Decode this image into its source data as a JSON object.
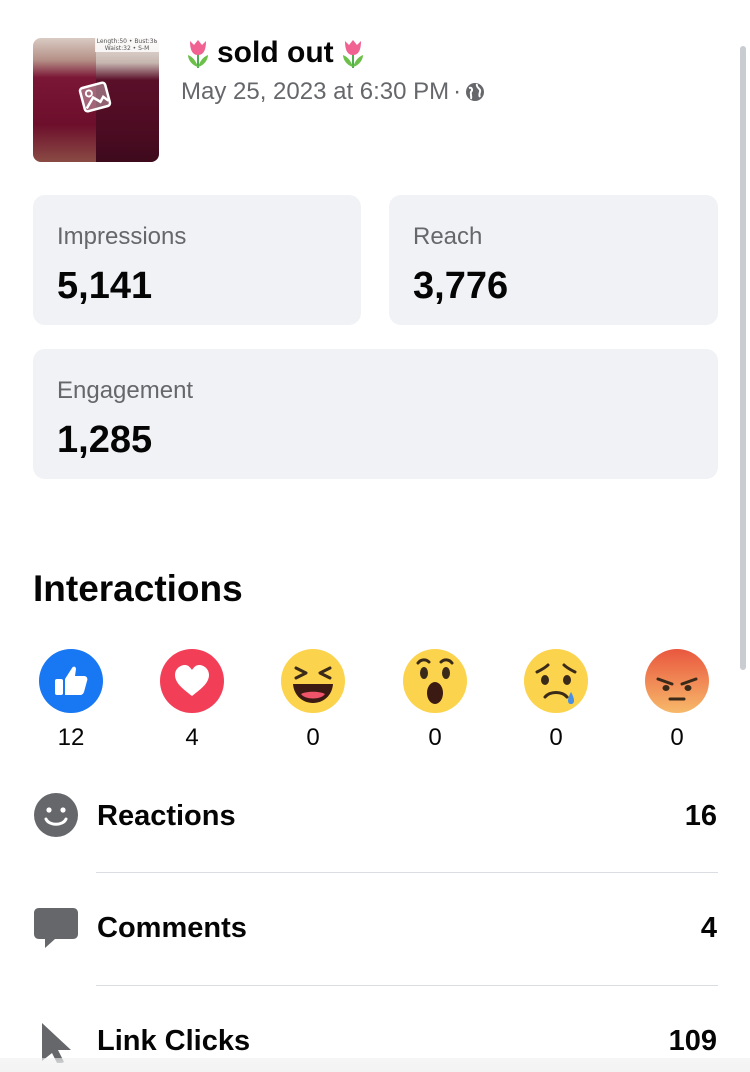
{
  "post": {
    "thumbnail_text": "Length:50 • Bust:38 Waist:32 • S-M",
    "title": "sold out",
    "date": "May 25, 2023 at 6:30 PM",
    "separator": "·"
  },
  "stats": [
    {
      "label": "Impressions",
      "value": "5,141"
    },
    {
      "label": "Reach",
      "value": "3,776"
    },
    {
      "label": "Engagement",
      "value": "1,285"
    }
  ],
  "interactions": {
    "title": "Interactions",
    "reactions": [
      {
        "icon": "like-icon",
        "count": "12"
      },
      {
        "icon": "love-icon",
        "count": "4"
      },
      {
        "icon": "haha-icon",
        "count": "0"
      },
      {
        "icon": "wow-icon",
        "count": "0"
      },
      {
        "icon": "sad-icon",
        "count": "0"
      },
      {
        "icon": "angry-icon",
        "count": "0"
      }
    ]
  },
  "metrics": [
    {
      "icon": "smiley-icon",
      "label": "Reactions",
      "value": "16"
    },
    {
      "icon": "comment-icon",
      "label": "Comments",
      "value": "4"
    },
    {
      "icon": "cursor-icon",
      "label": "Link Clicks",
      "value": "109"
    }
  ],
  "colors": {
    "card_bg": "#f0f2f5",
    "secondary_text": "#65676b",
    "like_blue": "#1877f2",
    "love_red": "#f33e58",
    "emoji_yellow": "#fcd34d",
    "angry_red": "#e9573f"
  }
}
